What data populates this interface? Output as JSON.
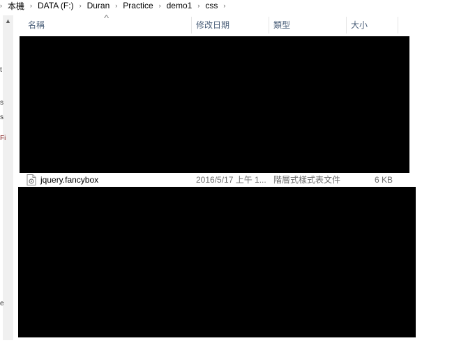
{
  "breadcrumb": {
    "items": [
      "本機",
      "DATA (F:)",
      "Duran",
      "Practice",
      "demo1",
      "css"
    ]
  },
  "nav_fragments": [
    "t",
    "s",
    "s",
    "Fi",
    "e"
  ],
  "columns": {
    "name": "名稱",
    "date_modified": "修改日期",
    "type": "類型",
    "size": "大小"
  },
  "files": [
    {
      "name": "jquery.fancybox",
      "date_modified": "2016/5/17 上午 1...",
      "type": "階層式樣式表文件",
      "size": "6 KB",
      "icon": "css-file-icon"
    }
  ],
  "colors": {
    "header_text": "#4c607a",
    "secondary_text": "#6d6d6d",
    "redaction": "#000000"
  }
}
